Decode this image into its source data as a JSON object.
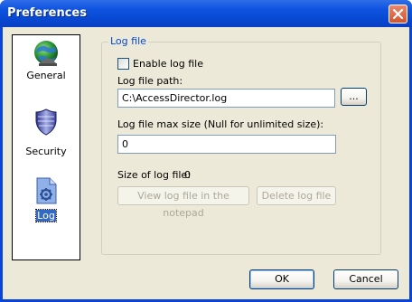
{
  "window": {
    "title": "Preferences"
  },
  "sidebar": {
    "items": [
      {
        "label": "General",
        "icon": "globe-icon"
      },
      {
        "label": "Security",
        "icon": "shield-icon"
      },
      {
        "label": "Log",
        "icon": "log-file-icon",
        "selected": true
      }
    ]
  },
  "log_group": {
    "title": "Log file",
    "enable_label": "Enable log file",
    "enable_checked": false,
    "path_label": "Log file path:",
    "path_value": "C:\\AccessDirector.log",
    "browse_label": "...",
    "maxsize_label": "Log file max size (Null for unlimited size):",
    "maxsize_value": "0",
    "size_label": "Size of log file:",
    "size_value": "0",
    "view_button": "View log file in the notepad",
    "delete_button": "Delete log file"
  },
  "footer": {
    "ok": "OK",
    "cancel": "Cancel"
  },
  "colors": {
    "title_bar": "#0a45d8",
    "group_title": "#0046d5",
    "selection": "#316ac5"
  }
}
